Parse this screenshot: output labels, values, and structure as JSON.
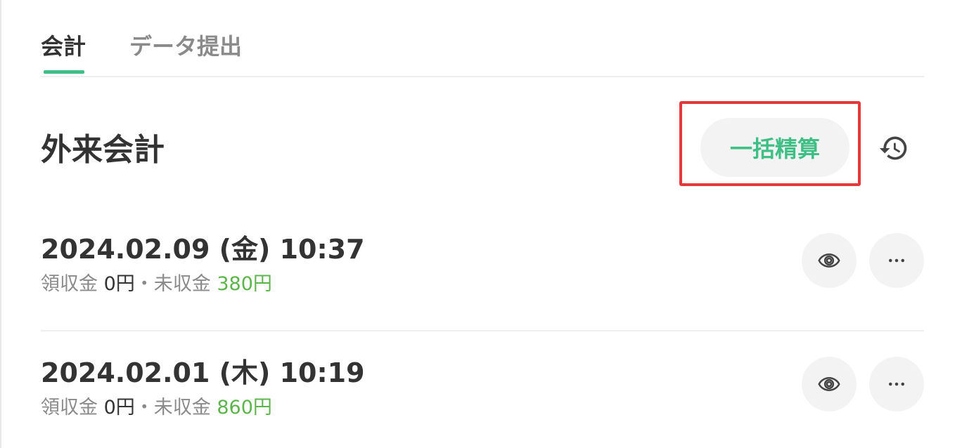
{
  "tabs": [
    {
      "label": "会計",
      "active": true
    },
    {
      "label": "データ提出",
      "active": false
    }
  ],
  "section": {
    "title": "外来会計",
    "bulk_button_label": "一括精算",
    "history_icon": "history-icon"
  },
  "rows": [
    {
      "datetime": "2024.02.09 (金) 10:37",
      "received_label": "領収金",
      "received_value": "0円",
      "separator": "・",
      "unpaid_label": "未収金",
      "unpaid_value": "380円"
    },
    {
      "datetime": "2024.02.01 (木) 10:19",
      "received_label": "領収金",
      "received_value": "0円",
      "separator": "・",
      "unpaid_label": "未収金",
      "unpaid_value": "860円"
    }
  ],
  "colors": {
    "accent": "#3fbf86",
    "unpaid": "#5cb54a",
    "highlight": "#e5383b"
  }
}
